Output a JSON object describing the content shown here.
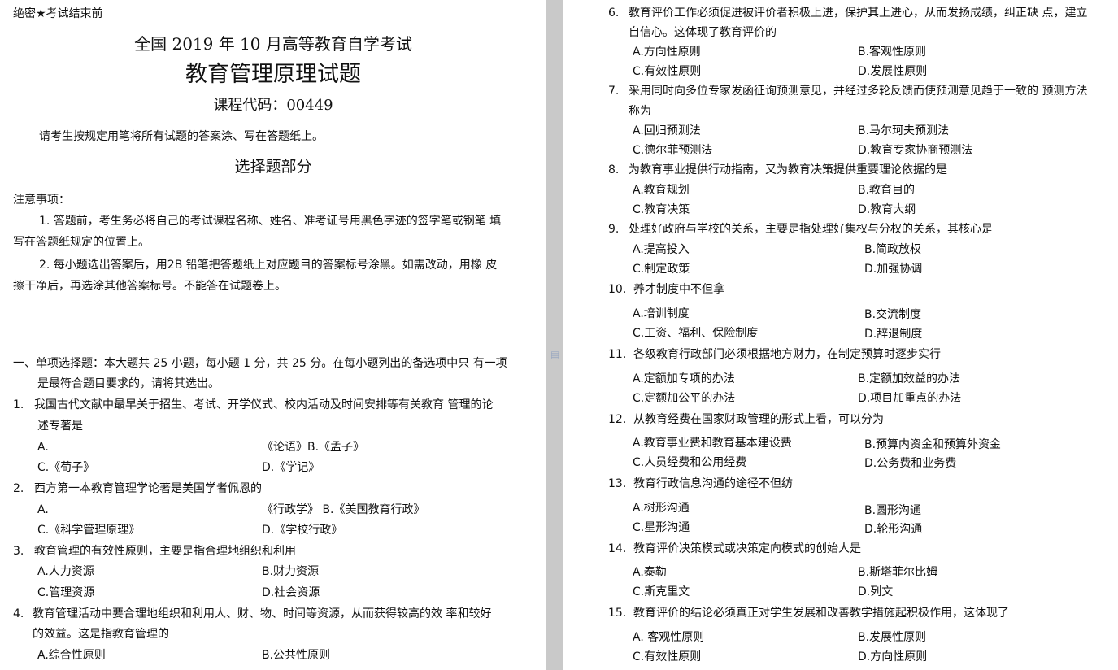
{
  "left": {
    "top_label": "绝密★考试结束前",
    "exam_title": "全国 2019 年 10 月高等教育自学考试",
    "subject_title": "教育管理原理试题",
    "course_code": "课程代码：00449",
    "instruction": "请考生按规定用笔将所有试题的答案涂、写在答题纸上。",
    "section_title": "选择题部分",
    "notes_heading": "注意事项：",
    "note1_line1": "1.  答题前，考生务必将自己的考试课程名称、姓名、准考证号用黑色字迹的签字笔或钢笔 填",
    "note1_line2": "写在答题纸规定的位置上。",
    "note2_line1": "2.  每小题选出答案后，用2B 铅笔把答题纸上对应题目的答案标号涂黑。如需改动，用橡 皮",
    "note2_line2": "擦干净后，再选涂其他答案标号。不能答在试题卷上。",
    "part1_line1": "一、单项选择题：本大题共 25 小题，每小题 1 分，共 25 分。在每小题列出的备选项中只 有一项",
    "part1_line2": "是最符合题目要求的，请将其选出。",
    "q1_num": "1.",
    "q1_line1": "我国古代文献中最早关于招生、考试、开学仪式、校内活动及时间安排等有关教育 管理的论",
    "q1_line2": "述专著是",
    "q1_a": "A.",
    "q1_ab": "《论语》B.《孟子》",
    "q1_c": "C.《荀子》",
    "q1_d": "D.《学记》",
    "q2_num": "2.",
    "q2_line1": "西方第一本教育管理学论著是美国学者佩恩的",
    "q2_a": "A.",
    "q2_ab": "《行政学》     B.《美国教育行政》",
    "q2_c": "C.《科学管理原理》",
    "q2_d": "D.《学校行政》",
    "q3_num": "3.",
    "q3_line1": "教育管理的有效性原则，主要是指合理地组织和利用",
    "q3_a": "A.人力资源",
    "q3_b": "B.财力资源",
    "q3_c": "C.管理资源",
    "q3_d": "D.社会资源",
    "q4_num": "4.",
    "q4_line1": "教育管理活动中要合理地组织和利用人、财、物、时间等资源，从而获得较高的效 率和较好",
    "q4_line2": "的效益。这是指教育管理的",
    "q4_a": "A.综合性原则",
    "q4_b": "B.公共性原则"
  },
  "right": {
    "q6_num": "6.",
    "q6_line1": "教育评价工作必须促进被评价者积极上进，保护其上进心，从而发扬成绩，纠正缺 点，建立",
    "q6_line2": "自信心。这体现了教育评价的",
    "q6_a": "A.方向性原则",
    "q6_b": "B.客观性原则",
    "q6_c": "C.有效性原则",
    "q6_d": "D.发展性原则",
    "q7_num": "7.",
    "q7_line1": "采用同时向多位专家发函征询预测意见，并经过多轮反馈而使预测意见趋于一致的 预测方法",
    "q7_line2": "称为",
    "q7_a": "A.回归预测法",
    "q7_b": "B.马尔珂夫预测法",
    "q7_c": "C.德尔菲预测法",
    "q7_d": "D.教育专家协商预测法",
    "q8_num": "8.",
    "q8_line1": "为教育事业提供行动指南，又为教育决策提供重要理论依据的是",
    "q8_a": "A.教育规划",
    "q8_b": "B.教育目的",
    "q8_c": "C.教育决策",
    "q8_d": "D.教育大纲",
    "q9_num": "9.",
    "q9_line1": "处理好政府与学校的关系，主要是指处理好集权与分权的关系，其核心是",
    "q9_a": "A.提高投入",
    "q9_b": "B.简政放权",
    "q9_c": "C.制定政策",
    "q9_d": "D.加强协调",
    "q10_num": "10.",
    "q10_line1": "养才制度中不但拿",
    "q10_a": "A.培训制度",
    "q10_b": "B.交流制度",
    "q10_c": "C.工资、福利、保险制度",
    "q10_d": "D.辞退制度",
    "q11_num": "11.",
    "q11_line1": "各级教育行政部门必须根据地方财力，在制定预算时逐步实行",
    "q11_a": "A.定额加专项的办法",
    "q11_b": "B.定额加效益的办法",
    "q11_c": "C.定额加公平的办法",
    "q11_d": "D.项目加重点的办法",
    "q12_num": "12.",
    "q12_line1": "从教育经费在国家财政管理的形式上看，可以分为",
    "q12_a": "A.教育事业费和教育基本建设费",
    "q12_b": "B.预算内资金和预算外资金",
    "q12_c": "C.人员经费和公用经费",
    "q12_d": "D.公务费和业务费",
    "q13_num": "13.",
    "q13_line1": "教育行政信息沟通的途径不但纺",
    "q13_a": "A.树形沟通",
    "q13_b": "B.圆形沟通",
    "q13_c": "C.星形沟通",
    "q13_d": "D.轮形沟通",
    "q14_num": "14.",
    "q14_line1": "教育评价决策模式或决策定向模式的创始人是",
    "q14_a": "A.泰勒",
    "q14_b": "B.斯塔菲尔比姆",
    "q14_c": "C.斯克里文",
    "q14_d": "D.列文",
    "q15_num": "15.",
    "q15_line1": "教育评价的结论必须真正对学生发展和改善教学措施起积极作用，这体现了",
    "q15_a": "A. 客观性原则",
    "q15_b": "B.发展性原则",
    "q15_c": "C.有效性原则",
    "q15_d": "D.方向性原则"
  }
}
